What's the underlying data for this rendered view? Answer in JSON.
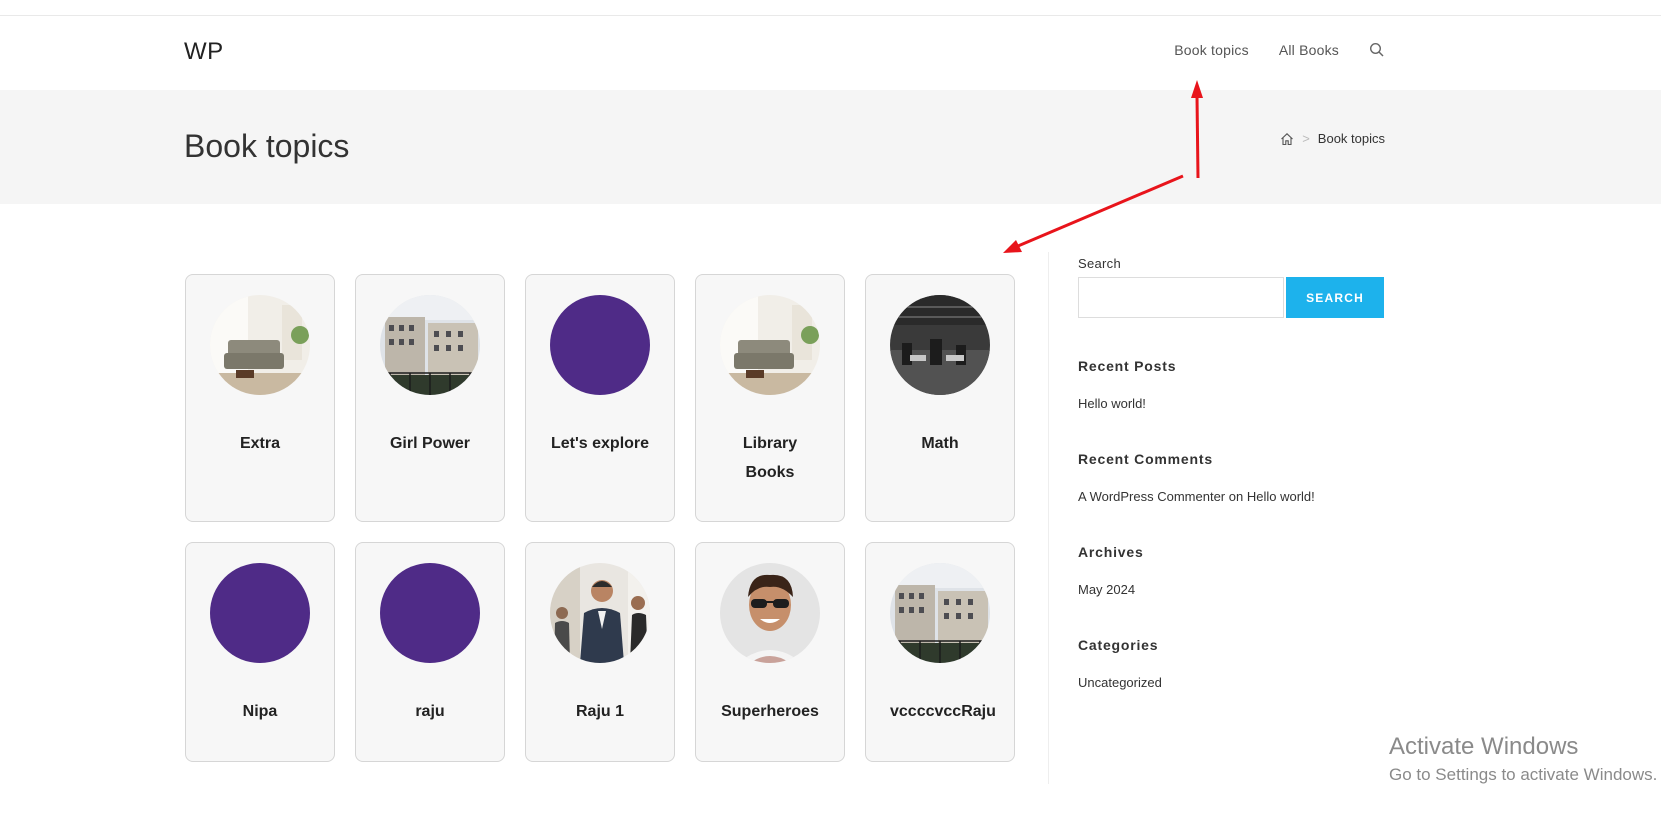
{
  "site": {
    "logo": "WP",
    "nav": [
      {
        "label": "Book topics"
      },
      {
        "label": "All Books"
      }
    ],
    "search_icon": "search-icon"
  },
  "page_header": {
    "title": "Book topics",
    "breadcrumb": {
      "home_icon": "home-icon",
      "separator": ">",
      "current": "Book topics"
    }
  },
  "topics": [
    {
      "name": "Extra",
      "image": "room"
    },
    {
      "name": "Girl Power",
      "image": "buildings"
    },
    {
      "name": "Let's explore",
      "image": "purple"
    },
    {
      "name": "Library Books",
      "image": "room"
    },
    {
      "name": "Math",
      "image": "office"
    },
    {
      "name": "Nipa",
      "image": "purple"
    },
    {
      "name": "raju",
      "image": "purple"
    },
    {
      "name": "Raju 1",
      "image": "business"
    },
    {
      "name": "Superheroes",
      "image": "person"
    },
    {
      "name": "vccccvccRaju",
      "image": "buildings"
    }
  ],
  "sidebar": {
    "search": {
      "label": "Search",
      "button": "SEARCH",
      "value": "",
      "placeholder": ""
    },
    "recent_posts": {
      "title": "Recent Posts",
      "items": [
        "Hello world!"
      ]
    },
    "recent_comments": {
      "title": "Recent Comments",
      "author": "A WordPress Commenter",
      "on": "on",
      "post": "Hello world!"
    },
    "archives": {
      "title": "Archives",
      "items": [
        "May 2024"
      ]
    },
    "categories": {
      "title": "Categories",
      "items": [
        "Uncategorized"
      ]
    }
  },
  "watermark": {
    "line1": "Activate Windows",
    "line2": "Go to Settings to activate Windows."
  },
  "colors": {
    "accent": "#1db2ec",
    "avatar_purple": "#4f2b87",
    "annotation_red": "#e8141b"
  }
}
